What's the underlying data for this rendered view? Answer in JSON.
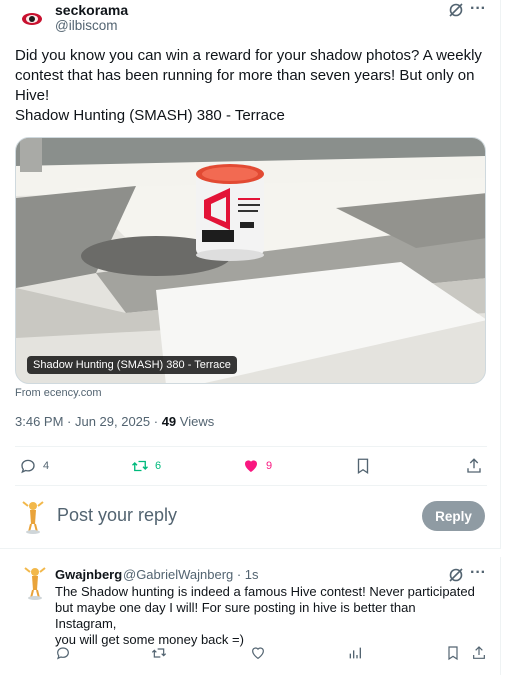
{
  "tweet": {
    "display_name": "seckorama",
    "handle": "@ilbiscom",
    "text_lines": [
      "Did you know you can win a reward for your shadow photos? A weekly",
      "contest that has been running for more than seven years! But only on",
      "Hive!",
      "Shadow Hunting (SMASH) 380 - Terrace"
    ],
    "media_caption": "Shadow Hunting (SMASH) 380 - Terrace",
    "source": "From ecency.com",
    "timestamp": "3:46 PM · Jun 29, 2025 · ",
    "views_count": "49",
    "views_label": " Views",
    "actions": {
      "replies": "4",
      "reposts": "6",
      "likes": "9"
    }
  },
  "composer": {
    "placeholder": "Post your reply",
    "reply_label": "Reply"
  },
  "reply": {
    "display_name": "Gwajnberg",
    "handle": "@GabrielWajnberg · 1s",
    "text_lines": [
      "The Shadow hunting is indeed a famous Hive contest! Never participated",
      "but maybe one day I will! For sure posting in hive is better than Instagram,",
      "you will get some money back =)"
    ]
  },
  "colors": {
    "like": "#f91880",
    "repost": "#00ba7c",
    "muted": "#536471",
    "reply_button": "#8f9ba3"
  },
  "icons": [
    "grok-icon",
    "more-icon",
    "reply-icon",
    "repost-icon",
    "heart-icon",
    "bookmark-icon",
    "share-icon",
    "analytics-icon"
  ]
}
